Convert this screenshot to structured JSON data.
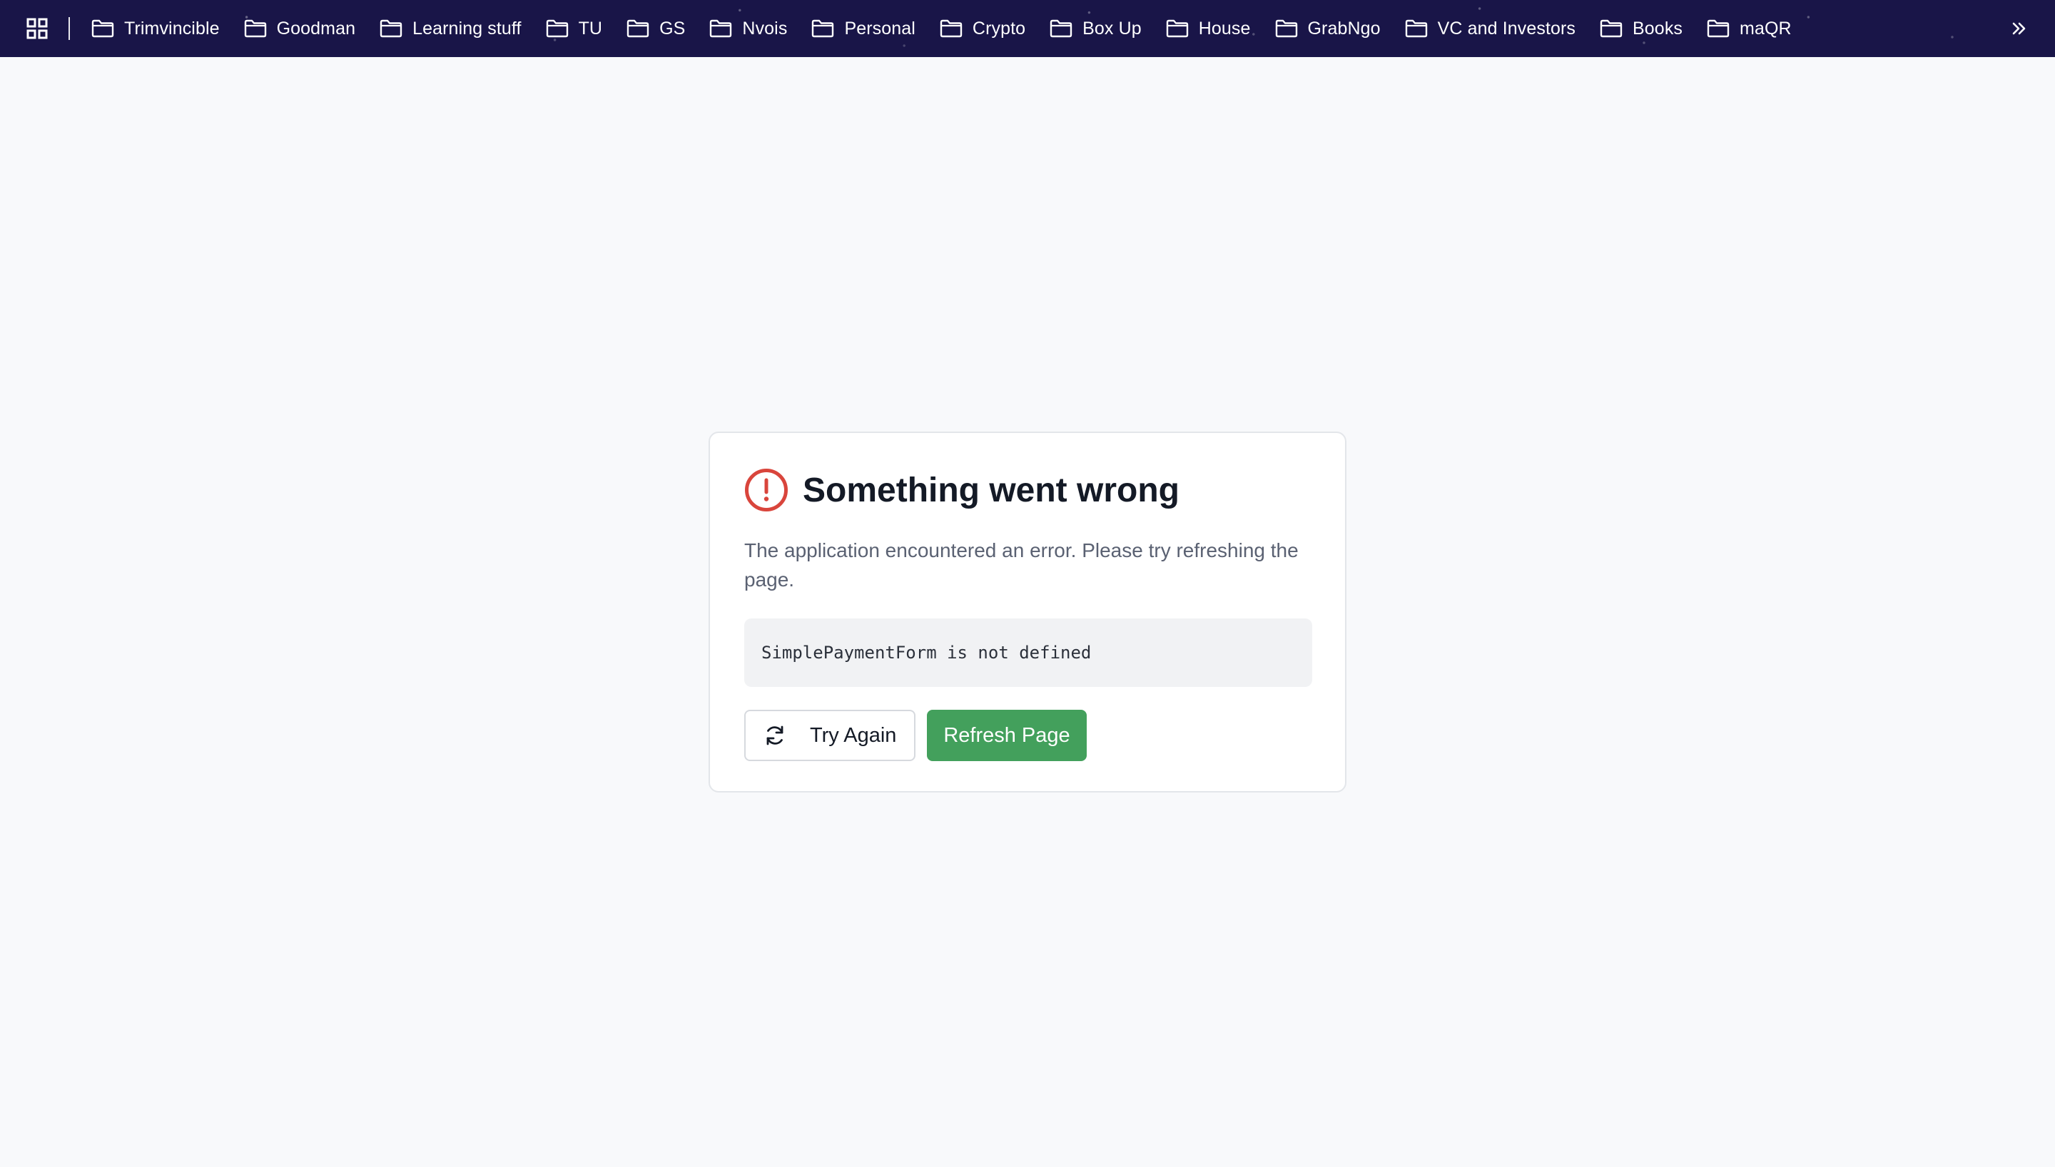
{
  "bookmarks_bar": {
    "apps_icon": "apps-grid-icon",
    "folder_icon": "folder-icon",
    "overflow_icon": "chevron-double-right-icon",
    "items": [
      {
        "label": "Trimvincible"
      },
      {
        "label": "Goodman"
      },
      {
        "label": "Learning stuff"
      },
      {
        "label": "TU"
      },
      {
        "label": "GS"
      },
      {
        "label": "Nvois"
      },
      {
        "label": "Personal"
      },
      {
        "label": "Crypto"
      },
      {
        "label": "Box Up"
      },
      {
        "label": "House"
      },
      {
        "label": "GrabNgo"
      },
      {
        "label": "VC and Investors"
      },
      {
        "label": "Books"
      },
      {
        "label": "maQR"
      }
    ]
  },
  "error": {
    "icon": "alert-circle-icon",
    "title": "Something went wrong",
    "message": "The application encountered an error. Please try refreshing the page.",
    "details": "SimplePaymentForm is not defined",
    "try_again_label": "Try Again",
    "try_again_icon": "refresh-icon",
    "refresh_label": "Refresh Page"
  },
  "colors": {
    "bookmarks_bar_bg": "#191548",
    "page_bg": "#f8f9fb",
    "error_icon": "#d9453c",
    "refresh_button_bg": "#43a05c",
    "details_bg": "#f1f2f4"
  }
}
